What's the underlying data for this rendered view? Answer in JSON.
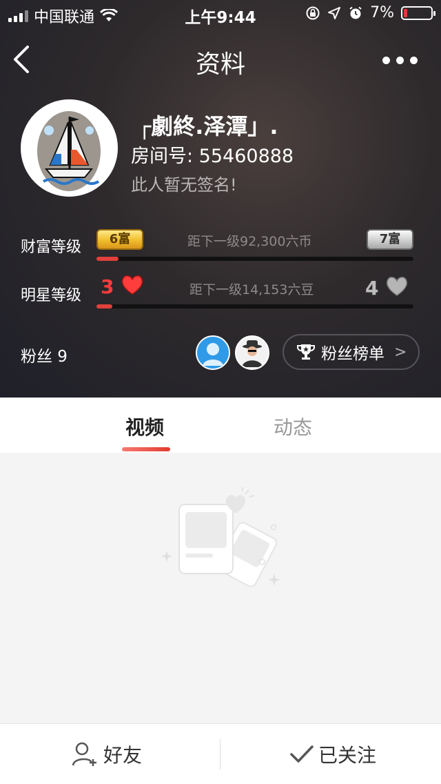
{
  "status_bar": {
    "carrier": "中国联通",
    "time": "上午9:44",
    "battery": "7%"
  },
  "nav": {
    "title": "资料"
  },
  "profile": {
    "nickname": "┌劇終.泽潭」.",
    "room": "房间号: 55460888",
    "signature": "此人暂无签名!"
  },
  "wealth": {
    "label": "财富等级",
    "current_badge": "6富",
    "next_badge": "7富",
    "next_text": "距下一级92,300六币",
    "progress": 0.07
  },
  "star": {
    "label": "明星等级",
    "current": "3",
    "next": "4",
    "next_text": "距下一级14,153六豆",
    "progress": 0.05
  },
  "fans": {
    "text": "粉丝 9",
    "rank_button": "粉丝榜单"
  },
  "tabs": [
    {
      "label": "视频",
      "active": true
    },
    {
      "label": "动态",
      "active": false
    }
  ],
  "bottom_bar": {
    "friend": "好友",
    "followed": "已关注"
  },
  "colors": {
    "accent": "#e43a2f",
    "hero_bg": "#2e2a2c"
  }
}
